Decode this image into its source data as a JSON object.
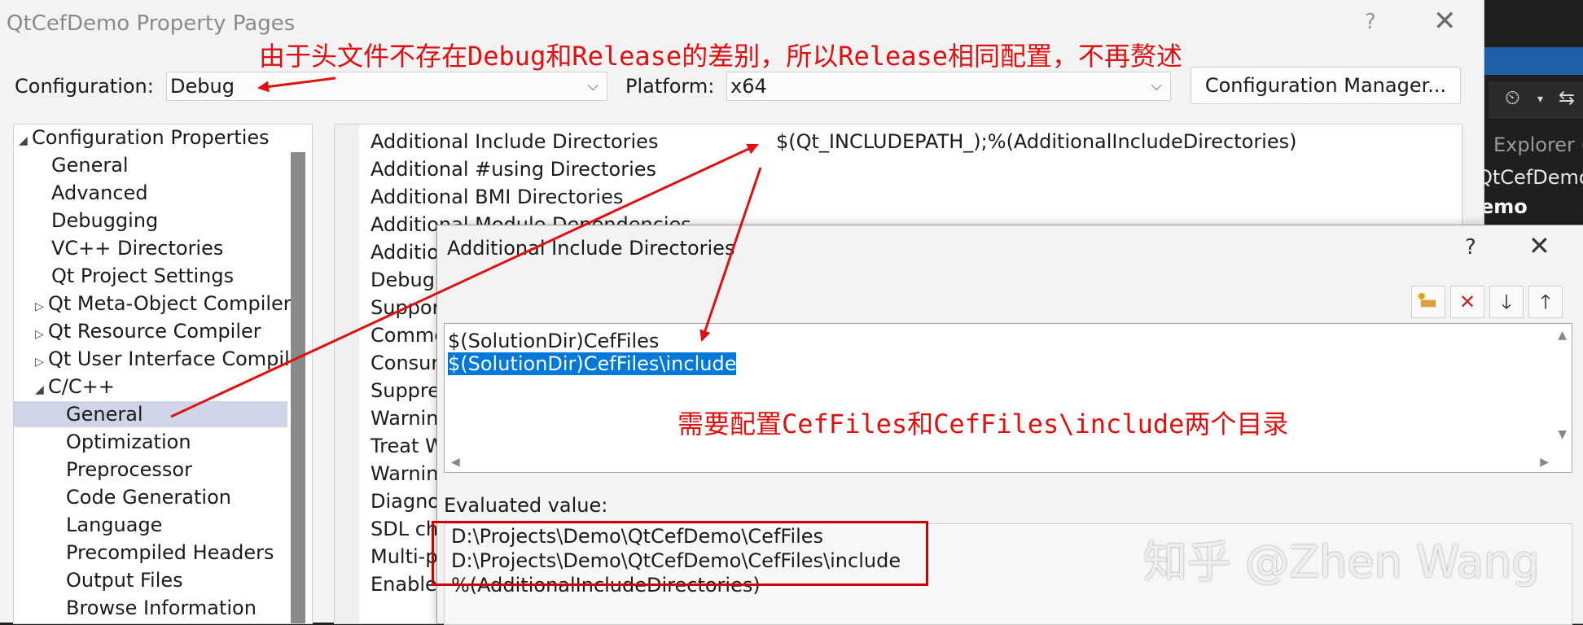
{
  "background_ide": {
    "bar_text": "er",
    "explorer_text": "Explorer (",
    "tree_item_1": "QtCefDemo",
    "tree_item_2": "emo"
  },
  "dialog": {
    "title": "QtCefDemo Property Pages",
    "help_glyph": "?",
    "close_glyph": "✕",
    "configuration_label": "Configuration:",
    "configuration_value": "Debug",
    "platform_label": "Platform:",
    "platform_value": "x64",
    "config_manager_label": "Configuration Manager..."
  },
  "tree": {
    "items": [
      {
        "label": "Configuration Properties",
        "arrow": "◢"
      },
      {
        "label": "General",
        "arrow": ""
      },
      {
        "label": "Advanced",
        "arrow": ""
      },
      {
        "label": "Debugging",
        "arrow": ""
      },
      {
        "label": "VC++ Directories",
        "arrow": ""
      },
      {
        "label": "Qt Project Settings",
        "arrow": ""
      },
      {
        "label": "Qt Meta-Object Compiler",
        "arrow": "▷"
      },
      {
        "label": "Qt Resource Compiler",
        "arrow": "▷"
      },
      {
        "label": "Qt User Interface Compile",
        "arrow": "▷"
      },
      {
        "label": "C/C++",
        "arrow": "◢"
      },
      {
        "label": "General",
        "arrow": ""
      },
      {
        "label": "Optimization",
        "arrow": ""
      },
      {
        "label": "Preprocessor",
        "arrow": ""
      },
      {
        "label": "Code Generation",
        "arrow": ""
      },
      {
        "label": "Language",
        "arrow": ""
      },
      {
        "label": "Precompiled Headers",
        "arrow": ""
      },
      {
        "label": "Output Files",
        "arrow": ""
      },
      {
        "label": "Browse Information",
        "arrow": ""
      }
    ]
  },
  "grid": {
    "rows": [
      {
        "name": "Additional Include Directories",
        "value": "$(Qt_INCLUDEPATH_);%(AdditionalIncludeDirectories)"
      },
      {
        "name": "Additional #using Directories",
        "value": ""
      },
      {
        "name": "Additional BMI Directories",
        "value": ""
      },
      {
        "name": "Additional Module Dependencies",
        "value": ""
      },
      {
        "name": "Additio",
        "value": ""
      },
      {
        "name": "Debug",
        "value": ""
      },
      {
        "name": "Suppor",
        "value": ""
      },
      {
        "name": "Commo",
        "value": ""
      },
      {
        "name": "Consur",
        "value": ""
      },
      {
        "name": "Suppre",
        "value": ""
      },
      {
        "name": "Warnin",
        "value": ""
      },
      {
        "name": "Treat W",
        "value": ""
      },
      {
        "name": "Warnin",
        "value": ""
      },
      {
        "name": "Diagno",
        "value": ""
      },
      {
        "name": "SDL ch",
        "value": ""
      },
      {
        "name": "Multi-p",
        "value": ""
      },
      {
        "name": "Enable",
        "value": ""
      }
    ]
  },
  "subdialog": {
    "title": "Additional Include Directories",
    "help_glyph": "?",
    "close_glyph": "✕",
    "tools": [
      "new-line",
      "delete",
      "move-down",
      "move-up"
    ],
    "lines": [
      "$(SolutionDir)CefFiles",
      "$(SolutionDir)CefFiles\\include"
    ],
    "evaluated_label": "Evaluated value:",
    "evaluated_lines": [
      "D:\\Projects\\Demo\\QtCefDemo\\CefFiles",
      "D:\\Projects\\Demo\\QtCefDemo\\CefFiles\\include",
      "%(AdditionalIncludeDirectories)"
    ]
  },
  "annotations": {
    "top_note": "由于头文件不存在Debug和Release的差别，所以Release相同配置，不再赘述",
    "mid_note": "需要配置CefFiles和CefFiles\\include两个目录",
    "watermark": "知乎 @Zhen Wang",
    "color": "#e01010"
  }
}
